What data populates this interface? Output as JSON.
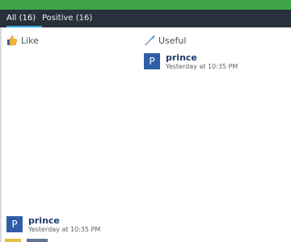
{
  "tabs": [
    {
      "label": "All (16)",
      "active": true
    },
    {
      "label": "Positive (16)",
      "active": false
    }
  ],
  "columns": {
    "like": {
      "label": "Like",
      "icon": "thumbs-up-icon"
    },
    "useful": {
      "label": "Useful",
      "icon": "wand-icon"
    }
  },
  "entries": {
    "useful_first": {
      "avatar_letter": "P",
      "name": "prince",
      "time": "Yesterday at 10:35 PM"
    },
    "like_bottom": {
      "avatar_letter": "P",
      "name": "prince",
      "time": "Yesterday at 10:35 PM"
    }
  },
  "colors": {
    "accent_green": "#3fa547",
    "tab_bar": "#26313b",
    "tab_underline": "#35a7e8",
    "avatar_blue": "#2f5ea7"
  }
}
